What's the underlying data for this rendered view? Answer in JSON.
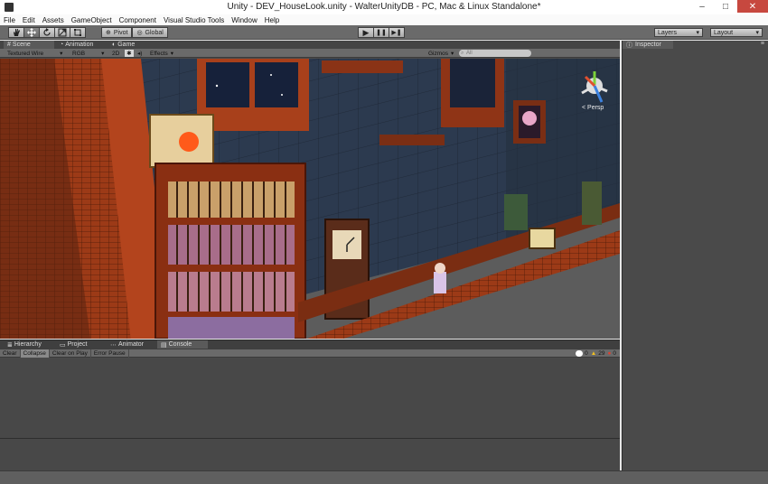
{
  "window": {
    "title": "Unity - DEV_HouseLook.unity - WalterUnityDB - PC, Mac & Linux Standalone*",
    "minimize": "–",
    "maximize": "□",
    "close": "✕"
  },
  "menu": [
    {
      "label": "File"
    },
    {
      "label": "Edit"
    },
    {
      "label": "Assets"
    },
    {
      "label": "GameObject"
    },
    {
      "label": "Component"
    },
    {
      "label": "Visual Studio Tools"
    },
    {
      "label": "Window"
    },
    {
      "label": "Help"
    }
  ],
  "toolbar": {
    "tools": [
      "hand-icon",
      "move-icon",
      "rotate-icon",
      "scale-icon",
      "rect-icon"
    ],
    "pivot": "Pivot",
    "global": "Global",
    "play": "▶",
    "pause": "❚❚",
    "step": "▶❚",
    "layers": "Layers",
    "layout": "Layout"
  },
  "tabs": {
    "scene": "Scene",
    "animation": "Animation",
    "game": "Game",
    "inspector": "Inspector",
    "hierarchy": "Hierarchy",
    "project": "Project",
    "animator": "Animator",
    "console": "Console"
  },
  "scene_toolbar": {
    "shading": "Textured Wire",
    "render": "RGB",
    "mode_2d": "2D",
    "lighting": "✱",
    "effects": "Effects",
    "gizmos": "Gizmos",
    "search_placeholder": "All",
    "persp": "< Persp"
  },
  "console_toolbar": {
    "clear": "Clear",
    "collapse": "Collapse",
    "clear_on_play": "Clear on Play",
    "error_pause": "Error Pause",
    "info_count": "0",
    "warn_count": "29",
    "error_count": "0"
  },
  "colors": {
    "editor_dark": "#4a4a4a",
    "toolbar_gray": "#6a6a6a",
    "wall_blue": "#2c3a4f",
    "wood_orange": "#b3441d",
    "close_red": "#c7483f"
  }
}
